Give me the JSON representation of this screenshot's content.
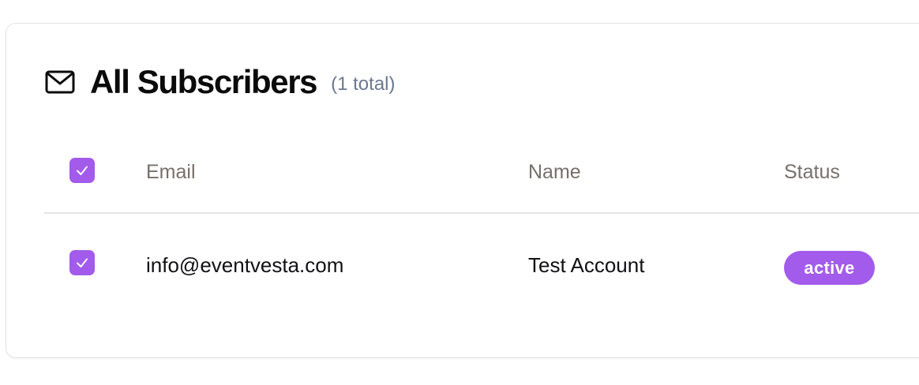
{
  "panel": {
    "icon": "mail-icon",
    "title": "All Subscribers",
    "count_label": "(1 total)"
  },
  "table": {
    "select_all_checked": true,
    "columns": [
      "Email",
      "Name",
      "Status"
    ],
    "rows": [
      {
        "checked": true,
        "email": "info@eventvesta.com",
        "name": "Test Account",
        "status": "active"
      }
    ]
  },
  "colors": {
    "accent": "#a25bea",
    "status_active": "#a25bea",
    "count_text": "#6c7891",
    "header_text": "#76706a"
  }
}
